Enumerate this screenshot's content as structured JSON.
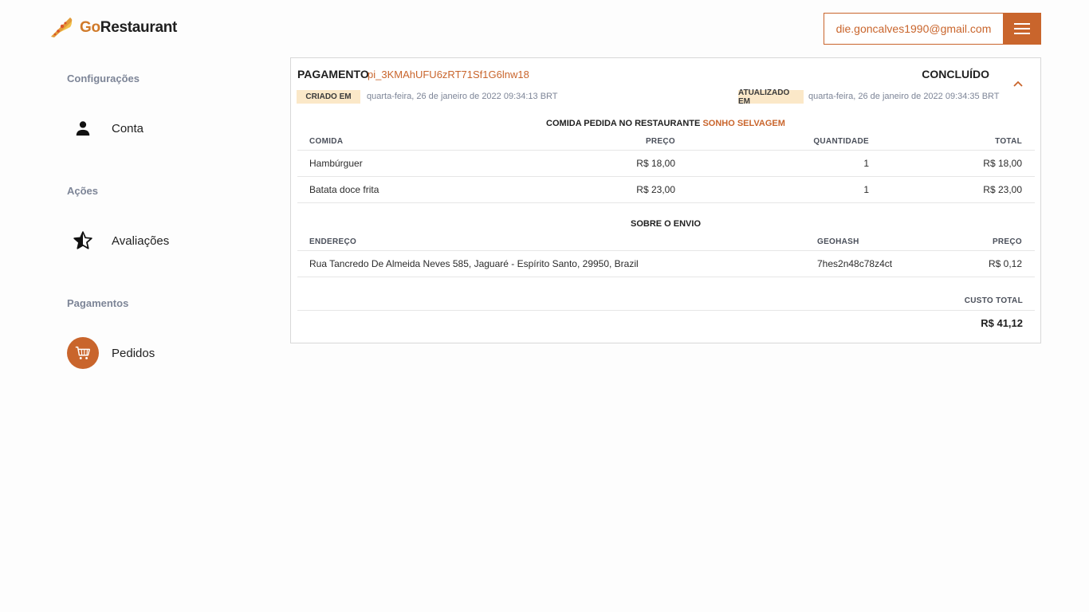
{
  "header": {
    "logo_go": "Go",
    "logo_rest": "Restaurant",
    "user_email": "die.goncalves1990@gmail.com"
  },
  "sidebar": {
    "sections": [
      {
        "title": "Configurações",
        "items": [
          {
            "label": "Conta",
            "icon": "person-icon"
          }
        ]
      },
      {
        "title": "Ações",
        "items": [
          {
            "label": "Avaliações",
            "icon": "star-half-icon"
          }
        ]
      },
      {
        "title": "Pagamentos",
        "items": [
          {
            "label": "Pedidos",
            "icon": "cart-icon",
            "active": true
          }
        ]
      }
    ]
  },
  "payment": {
    "title": "PAGAMENTO",
    "id": "pi_3KMAhUFU6zRT71Sf1G6lnw18",
    "status": "CONCLUÍDO",
    "created_label": "CRIADO EM",
    "created_date": "quarta-feira, 26 de janeiro de 2022 09:34:13 BRT",
    "updated_label": "ATUALIZADO EM",
    "updated_date": "quarta-feira, 26 de janeiro de 2022 09:34:35 BRT"
  },
  "order": {
    "title_prefix": "COMIDA PEDIDA NO RESTAURANTE",
    "restaurant": "SONHO SELVAGEM",
    "columns": [
      "COMIDA",
      "PREÇO",
      "QUANTIDADE",
      "TOTAL"
    ],
    "rows": [
      {
        "food": "Hambúrguer",
        "price": "R$ 18,00",
        "qty": "1",
        "total": "R$ 18,00"
      },
      {
        "food": "Batata doce frita",
        "price": "R$ 23,00",
        "qty": "1",
        "total": "R$ 23,00"
      }
    ]
  },
  "shipping": {
    "title": "SOBRE O ENVIO",
    "columns": [
      "ENDEREÇO",
      "GEOHASH",
      "PREÇO"
    ],
    "address": "Rua Tancredo De Almeida Neves 585, Jaguaré - Espírito Santo, 29950, Brazil",
    "geohash": "7hes2n48c78z4ct",
    "price": "R$ 0,12"
  },
  "summary": {
    "total_label": "CUSTO TOTAL",
    "total_value": "R$ 41,12"
  },
  "colors": {
    "accent": "#c9652c",
    "badge_bg": "#fbe8c8",
    "section_gray": "#7d8597"
  }
}
